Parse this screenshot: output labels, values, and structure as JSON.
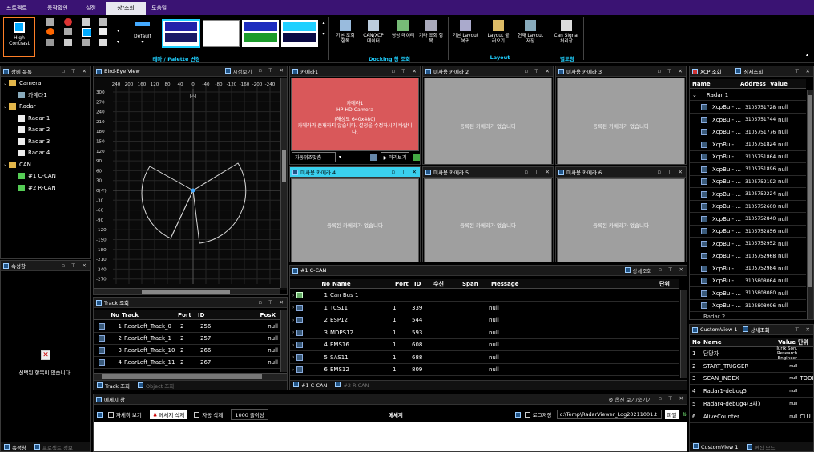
{
  "menu": {
    "tabs": [
      "프로젝트",
      "동작확인",
      "설정",
      "창/조회",
      "도움말"
    ],
    "active": 3
  },
  "ribbon": {
    "high_contrast": "High Contrast",
    "default": "Default",
    "group_theme": "테마 / Palette 변경",
    "group_docking": "Docking 창 조회",
    "group_layout": "Layout",
    "group_etc": "별도창",
    "docking_buttons": [
      "기본 조회 항목",
      "CAN/XCP 데이터",
      "영상 데이터",
      "기타 조회 항목"
    ],
    "layout_buttons": [
      "기본 Layout 복귀",
      "Layout 불러오기",
      "현재 Layout 저장"
    ],
    "etc_buttons": [
      "Can Signal 처리창"
    ]
  },
  "palette": [
    {
      "top": "#2222aa",
      "bottom": "#1a1a66"
    },
    {
      "top": "#ffffff",
      "bottom": "#ffffff"
    },
    {
      "top": "#1e2dbf",
      "bottom": "#1b9b2a"
    },
    {
      "top": "#1fd0ff",
      "bottom": "#0a0a44"
    }
  ],
  "tree": {
    "title": "장비 목록",
    "items": [
      {
        "label": "Camera",
        "level": 0,
        "type": "folder"
      },
      {
        "label": "카메라1",
        "level": 1,
        "type": "camera"
      },
      {
        "label": "Radar",
        "level": 0,
        "type": "folder"
      },
      {
        "label": "Radar 1",
        "level": 1,
        "type": "radar"
      },
      {
        "label": "Radar 2",
        "level": 1,
        "type": "radar"
      },
      {
        "label": "Radar 3",
        "level": 1,
        "type": "radar"
      },
      {
        "label": "Radar 4",
        "level": 1,
        "type": "radar"
      },
      {
        "label": "CAN",
        "level": 0,
        "type": "folder"
      },
      {
        "label": "#1 C-CAN",
        "level": 1,
        "type": "can"
      },
      {
        "label": "#2 R-CAN",
        "level": 1,
        "type": "can"
      }
    ]
  },
  "props": {
    "title": "속성창",
    "empty": "선택된 항목이 없습니다.",
    "tabs": [
      "속성창",
      "프로젝트 정보"
    ]
  },
  "bev": {
    "title": "Bird-Eye View",
    "view_btn": "시점보기",
    "x_ticks": [
      "240",
      "200",
      "160",
      "120",
      "80",
      "40",
      "0",
      "-40",
      "-80",
      "-120",
      "-160",
      "-200",
      "-240"
    ],
    "y_ticks": [
      "300",
      "270",
      "240",
      "210",
      "180",
      "150",
      "120",
      "90",
      "60",
      "30",
      "0(-Y)",
      "-30",
      "-60",
      "-90",
      "-120",
      "-150",
      "-180",
      "-210",
      "-240",
      "-270"
    ],
    "x_axis_label": "[X]"
  },
  "track": {
    "title": "Track 조회",
    "cols": [
      "No",
      "Track",
      "Port",
      "ID",
      "PosX"
    ],
    "rows": [
      {
        "no": "1",
        "track": "RearLeft_Track_0",
        "port": "2",
        "id": "256",
        "posx": "null"
      },
      {
        "no": "2",
        "track": "RearLeft_Track_1",
        "port": "2",
        "id": "257",
        "posx": "null"
      },
      {
        "no": "3",
        "track": "RearLeft_Track_10",
        "port": "2",
        "id": "266",
        "posx": "null"
      },
      {
        "no": "4",
        "track": "RearLeft_Track_11",
        "port": "2",
        "id": "267",
        "posx": "null"
      }
    ],
    "tabs": [
      "Track 조회",
      "Object 조회"
    ]
  },
  "cameras": [
    {
      "title": "카메라1",
      "active": true,
      "lines": [
        "카메라1",
        "HP HD Camera",
        "(해상도 640x480)",
        "카메라가 존재하지 않습니다. 설정을 수정하시기 바랍니다."
      ]
    },
    {
      "title": "미사용 카메라 2",
      "msg": "등록된 카메라가 없습니다"
    },
    {
      "title": "미사용 카메라 3",
      "msg": "등록된 카메라가 없습니다"
    },
    {
      "title": "미사용 카메라 4",
      "msg": "등록된 카메라가 없습니다",
      "selected": true
    },
    {
      "title": "미사용 카메라 5",
      "msg": "등록된 카메라가 없습니다"
    },
    {
      "title": "미사용 카메라 6",
      "msg": "등록된 카메라가 없습니다"
    }
  ],
  "cam_toolbar": {
    "select": "자동위즈맞춤",
    "play": "미리보기"
  },
  "ccan": {
    "title": "#1 C-CAN",
    "btn": "상세조회",
    "cols": [
      "No",
      "Name",
      "Port",
      "ID",
      "수신",
      "Span",
      "Message",
      "단위"
    ],
    "rows": [
      {
        "no": "1",
        "name": "Can Bus 1",
        "port": "",
        "id": "",
        "msg": ""
      },
      {
        "no": "1",
        "name": "TCS11",
        "port": "1",
        "id": "339",
        "msg": "null"
      },
      {
        "no": "2",
        "name": "ESP12",
        "port": "1",
        "id": "544",
        "msg": "null"
      },
      {
        "no": "3",
        "name": "MDPS12",
        "port": "1",
        "id": "593",
        "msg": "null"
      },
      {
        "no": "4",
        "name": "EMS16",
        "port": "1",
        "id": "608",
        "msg": "null"
      },
      {
        "no": "5",
        "name": "SAS11",
        "port": "1",
        "id": "688",
        "msg": "null"
      },
      {
        "no": "6",
        "name": "EMS12",
        "port": "1",
        "id": "809",
        "msg": "null"
      }
    ],
    "tabs": [
      "#1 C-CAN",
      "#2 R-CAN"
    ]
  },
  "xcp": {
    "title": "XCP 조회",
    "btn": "상세조회",
    "cols": [
      "Name",
      "Address",
      "Value"
    ],
    "group": "Radar 1",
    "rows": [
      {
        "name": "XcpBu - ...",
        "addr": "3105751728",
        "val": "null"
      },
      {
        "name": "XcpBu - ...",
        "addr": "3105751744",
        "val": "null"
      },
      {
        "name": "XcpBu - ...",
        "addr": "3105751776",
        "val": "null"
      },
      {
        "name": "XcpBu - ...",
        "addr": "3105751824",
        "val": "null"
      },
      {
        "name": "XcpBu - ...",
        "addr": "3105751864",
        "val": "null"
      },
      {
        "name": "XcpBu - ...",
        "addr": "3105751896",
        "val": "null"
      },
      {
        "name": "XcpBu - ...",
        "addr": "3105752192",
        "val": "null"
      },
      {
        "name": "XcpBu - ...",
        "addr": "3105752224",
        "val": "null"
      },
      {
        "name": "XcpBu - ...",
        "addr": "3105752600",
        "val": "null"
      },
      {
        "name": "XcpBu - ...",
        "addr": "3105752840",
        "val": "null"
      },
      {
        "name": "XcpBu - ...",
        "addr": "3105752856",
        "val": "null"
      },
      {
        "name": "XcpBu - ...",
        "addr": "3105752952",
        "val": "null"
      },
      {
        "name": "XcpBu - ...",
        "addr": "3105752968",
        "val": "null"
      },
      {
        "name": "XcpBu - ...",
        "addr": "3105752984",
        "val": "null"
      },
      {
        "name": "XcpBu - ...",
        "addr": "3105808064",
        "val": "null"
      },
      {
        "name": "XcpBu - ...",
        "addr": "3105808080",
        "val": "null"
      },
      {
        "name": "XcpBu - ...",
        "addr": "3105808096",
        "val": "null"
      }
    ],
    "next_group": "Radar 2"
  },
  "custom": {
    "title": "CustomView 1",
    "btn": "상세조회",
    "cols": [
      "No",
      "Name",
      "Value",
      "단위"
    ],
    "rows": [
      {
        "no": "1",
        "name": "담당자",
        "val": "Jurik Son, Research Engineer",
        "unit": ""
      },
      {
        "no": "2",
        "name": "START_TRIGGER",
        "val": "null",
        "unit": ""
      },
      {
        "no": "3",
        "name": "SCAN_INDEX",
        "val": "null",
        "unit": "TOOL"
      },
      {
        "no": "4",
        "name": "Radar1-debug5",
        "val": "null",
        "unit": ""
      },
      {
        "no": "5",
        "name": "Radar4-debug4(3채)",
        "val": "null",
        "unit": ""
      },
      {
        "no": "6",
        "name": "AliveCounter",
        "val": "null",
        "unit": "CLU"
      }
    ],
    "tabs": [
      "CustomView 1",
      "편집 모드"
    ]
  },
  "messages": {
    "title": "메세지 창",
    "toggle": "옵션 보기/숨기기",
    "detail": "자세히 보기",
    "clear": "메세지 삭제",
    "auto_delete": "자동 삭제",
    "count": "1000 줄이상",
    "center": "메세지",
    "log_save": "로그저장",
    "path": "c:\\Temp\\RadarViewer_Log20211001.t",
    "file_btn": "파일"
  }
}
